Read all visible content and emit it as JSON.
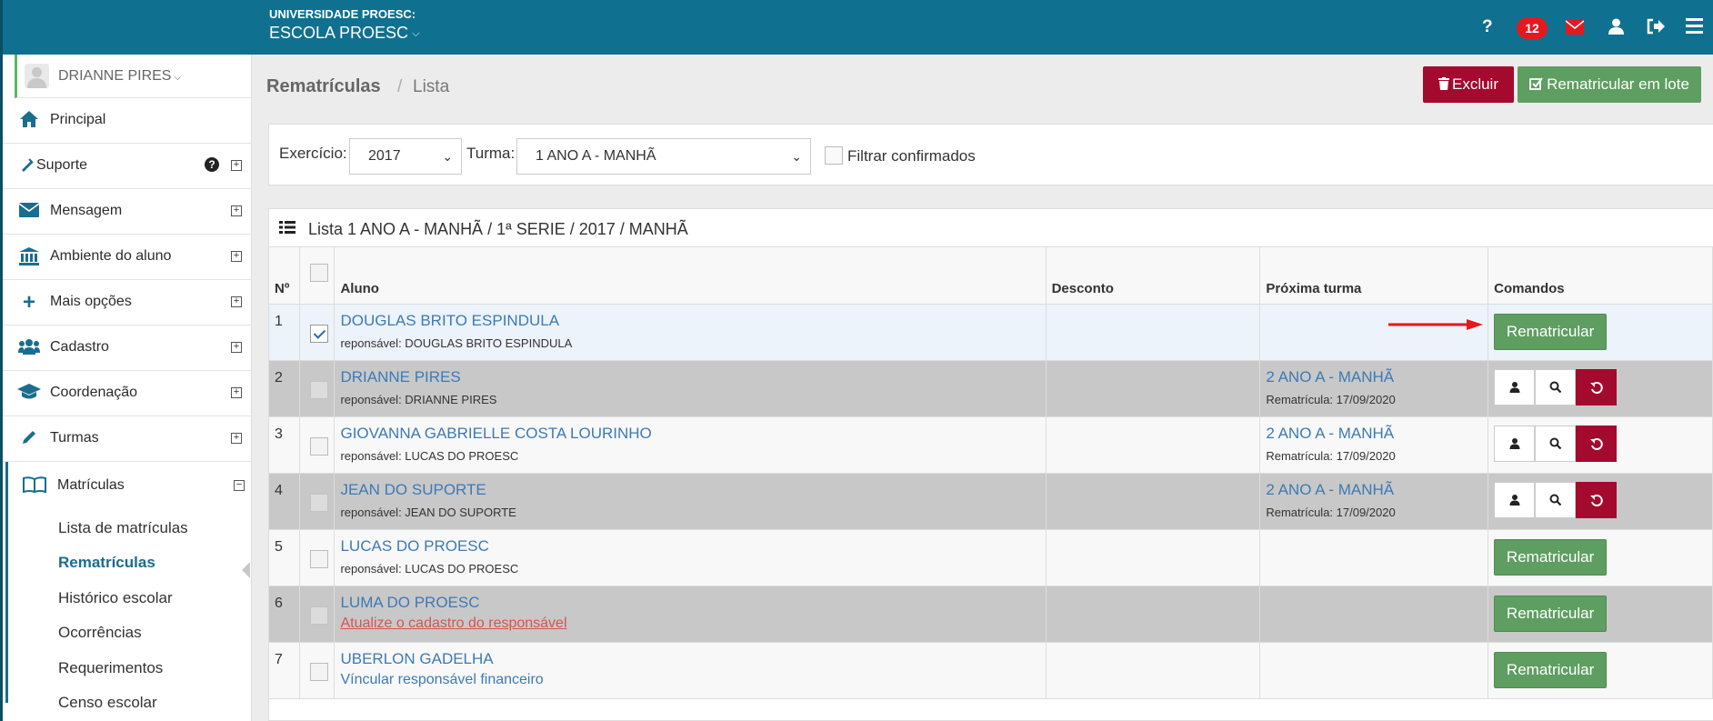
{
  "topbar": {
    "school_label": "UNIVERSIDADE PROESC:",
    "school_name": "ESCOLA PROESC",
    "notifications": "12",
    "icons": [
      "help-icon",
      "notifications-badge",
      "mail-icon",
      "user-icon",
      "logout-icon",
      "menu-icon"
    ]
  },
  "sidebar": {
    "user_name": "DRIANNE PIRES",
    "items": [
      {
        "label": "Principal",
        "icon": "home-icon"
      },
      {
        "label": "Suporte",
        "icon": "support-icon"
      },
      {
        "label": "Mensagem",
        "icon": "envelope-icon"
      },
      {
        "label": "Ambiente do aluno",
        "icon": "bank-icon"
      },
      {
        "label": "Mais opções",
        "icon": "plus-icon"
      },
      {
        "label": "Cadastro",
        "icon": "users-icon"
      },
      {
        "label": "Coordenação",
        "icon": "graduation-cap-icon"
      },
      {
        "label": "Turmas",
        "icon": "pencil-icon"
      },
      {
        "label": "Matrículas",
        "icon": "book-icon"
      }
    ],
    "submenu": [
      "Lista de matrículas",
      "Rematrículas",
      "Histórico escolar",
      "Ocorrências",
      "Requerimentos",
      "Censo escolar"
    ]
  },
  "page": {
    "title": "Rematrículas",
    "separator": "/",
    "breadcrumb": "Lista",
    "btn_excluir": "Excluir",
    "btn_lote": "Rematricular em lote"
  },
  "filters": {
    "exercicio_label": "Exercício:",
    "exercicio_value": "2017",
    "turma_label": "Turma:",
    "turma_value": "1 ANO A - MANHÃ",
    "confirmados_label": "Filtrar confirmados"
  },
  "list": {
    "title": "Lista 1 ANO A - MANHÃ / 1ª SERIE / 2017 / MANHÃ",
    "headers": {
      "num": "Nº",
      "aluno": "Aluno",
      "desconto": "Desconto",
      "proxima": "Próxima turma",
      "comandos": "Comandos"
    },
    "rows": [
      {
        "num": "1",
        "name": "DOUGLAS BRITO ESPINDULA",
        "resp": "reponsável: DOUGLAS BRITO ESPINDULA",
        "next": "",
        "date": "",
        "action": "Rematricular",
        "checked": true
      },
      {
        "num": "2",
        "name": "DRIANNE PIRES",
        "resp": "reponsável: DRIANNE PIRES",
        "next": "2 ANO A - MANHÃ",
        "date": "Rematrícula: 17/09/2020",
        "action": ""
      },
      {
        "num": "3",
        "name": "GIOVANNA GABRIELLE COSTA LOURINHO",
        "resp": "reponsável: LUCAS DO PROESC",
        "next": "2 ANO A - MANHÃ",
        "date": "Rematrícula: 17/09/2020",
        "action": ""
      },
      {
        "num": "4",
        "name": "JEAN DO SUPORTE",
        "resp": "reponsável: JEAN DO SUPORTE",
        "next": "2 ANO A - MANHÃ",
        "date": "Rematrícula: 17/09/2020",
        "action": ""
      },
      {
        "num": "5",
        "name": "LUCAS DO PROESC",
        "resp": "reponsável: LUCAS DO PROESC",
        "next": "",
        "date": "",
        "action": "Rematricular"
      },
      {
        "num": "6",
        "name": "LUMA DO PROESC",
        "warn": "Atualize o cadastro do responsável",
        "next": "",
        "date": "",
        "action": "Rematricular"
      },
      {
        "num": "7",
        "name": "UBERLON GADELHA",
        "link": "Víncular responsável financeiro",
        "next": "",
        "date": "",
        "action": "Rematricular"
      }
    ]
  },
  "colors": {
    "topbar": "#0f718f",
    "accent": "#1a6d8f",
    "danger": "#a4092e",
    "success": "#5e9e61",
    "link": "#3d7ab5"
  }
}
